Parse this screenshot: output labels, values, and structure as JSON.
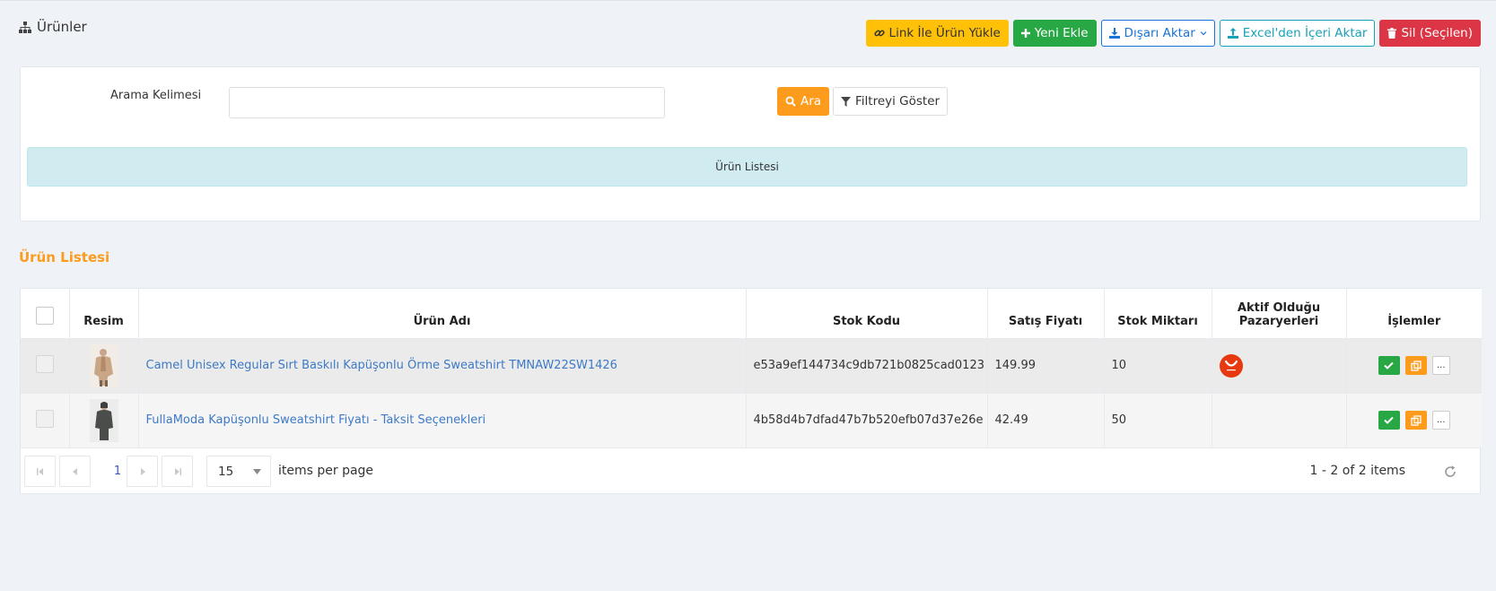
{
  "header": {
    "title": "Ürünler",
    "buttons": {
      "link_upload": "Link İle Ürün Yükle",
      "add_new": "Yeni Ekle",
      "export": "Dışarı Aktar",
      "excel_import": "Excel'den İçeri Aktar",
      "delete_selected": "Sil (Seçilen)"
    }
  },
  "search": {
    "label": "Arama Kelimesi",
    "value": "",
    "search_button": "Ara",
    "filter_button": "Filtreyi Göster",
    "info_bar": "Ürün Listesi"
  },
  "section_title": "Ürün Listesi",
  "grid": {
    "columns": {
      "image": "Resim",
      "name": "Ürün Adı",
      "sku": "Stok Kodu",
      "price": "Satış Fiyatı",
      "stock": "Stok Miktarı",
      "markets": "Aktif Olduğu Pazaryerleri",
      "actions": "İşlemler"
    },
    "rows": [
      {
        "name": "Camel Unisex Regular Sırt Baskılı Kapüşonlu Örme Sweatshirt TMNAW22SW1426",
        "sku": "e53a9ef144734c9db721b0825cad0123",
        "price": "149.99",
        "stock": "10",
        "more": "...",
        "has_market": true
      },
      {
        "name": "FullaModa Kapüşonlu Sweatshirt Fiyatı - Taksit Seçenekleri",
        "sku": "4b58d4b7dfad47b7b520efb07d37e26e",
        "price": "42.49",
        "stock": "50",
        "more": "...",
        "has_market": false
      }
    ]
  },
  "pager": {
    "current_page": "1",
    "page_size": "15",
    "items_per_page_label": "items per page",
    "info": "1 - 2 of 2 items"
  },
  "colors": {
    "accent_orange": "#fd9b1c",
    "success_green": "#28a745",
    "danger_red": "#dc3545",
    "warning_yellow": "#ffc107",
    "link_blue": "#3d7ac7"
  }
}
